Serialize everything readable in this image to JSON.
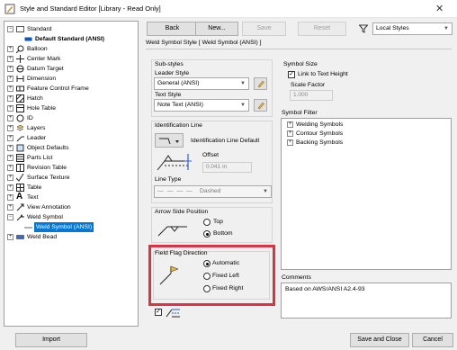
{
  "window": {
    "title": "Style and Standard Editor [Library - Read Only]"
  },
  "tree": {
    "items": [
      {
        "label": "Standard"
      },
      {
        "label": "Default Standard (ANSI)"
      },
      {
        "label": "Balloon"
      },
      {
        "label": "Center Mark"
      },
      {
        "label": "Datum Target"
      },
      {
        "label": "Dimension"
      },
      {
        "label": "Feature Control Frame"
      },
      {
        "label": "Hatch"
      },
      {
        "label": "Hole Table"
      },
      {
        "label": "ID"
      },
      {
        "label": "Layers"
      },
      {
        "label": "Leader"
      },
      {
        "label": "Object Defaults"
      },
      {
        "label": "Parts List"
      },
      {
        "label": "Revision Table"
      },
      {
        "label": "Surface Texture"
      },
      {
        "label": "Table"
      },
      {
        "label": "Text"
      },
      {
        "label": "View Annotation"
      },
      {
        "label": "Weld Symbol"
      },
      {
        "label": "Weld Symbol (ANSI)"
      },
      {
        "label": "Weld Bead"
      }
    ]
  },
  "toolbar": {
    "back": "Back",
    "new": "New...",
    "save": "Save",
    "reset": "Reset",
    "filter": "Local Styles"
  },
  "main": {
    "heading": "Weld Symbol Style [ Weld Symbol (ANSI) ]",
    "substyles": {
      "label": "Sub-styles",
      "leader_label": "Leader Style",
      "leader_value": "General (ANSI)",
      "text_label": "Text Style",
      "text_value": "Note Text (ANSI)"
    },
    "identification": {
      "label": "Identification Line",
      "default_label": "Identification Line Default",
      "offset_label": "Offset",
      "offset_value": "0.041 in",
      "linetype_label": "Line Type",
      "linetype_value": "Dashed"
    },
    "arrow_side": {
      "label": "Arrow Side Position",
      "top": "Top",
      "bottom": "Bottom"
    },
    "field_flag": {
      "label": "Field Flag Direction",
      "automatic": "Automatic",
      "fixed_left": "Fixed Left",
      "fixed_right": "Fixed Right"
    },
    "symbol_size": {
      "label": "Symbol Size",
      "link_label": "Link to Text Height",
      "scale_label": "Scale Factor",
      "scale_value": "1.000"
    },
    "symbol_filter": {
      "label": "Symbol Filter",
      "items": [
        "Welding Symbols",
        "Contour Symbols",
        "Backing Symbols"
      ]
    },
    "comments": {
      "label": "Comments",
      "text": "Based on AWS/ANSI A2.4-93"
    }
  },
  "footer": {
    "import": "Import",
    "save_close": "Save and Close",
    "cancel": "Cancel"
  },
  "colors": {
    "highlight": "#d9343f",
    "selection": "#0078d7"
  }
}
